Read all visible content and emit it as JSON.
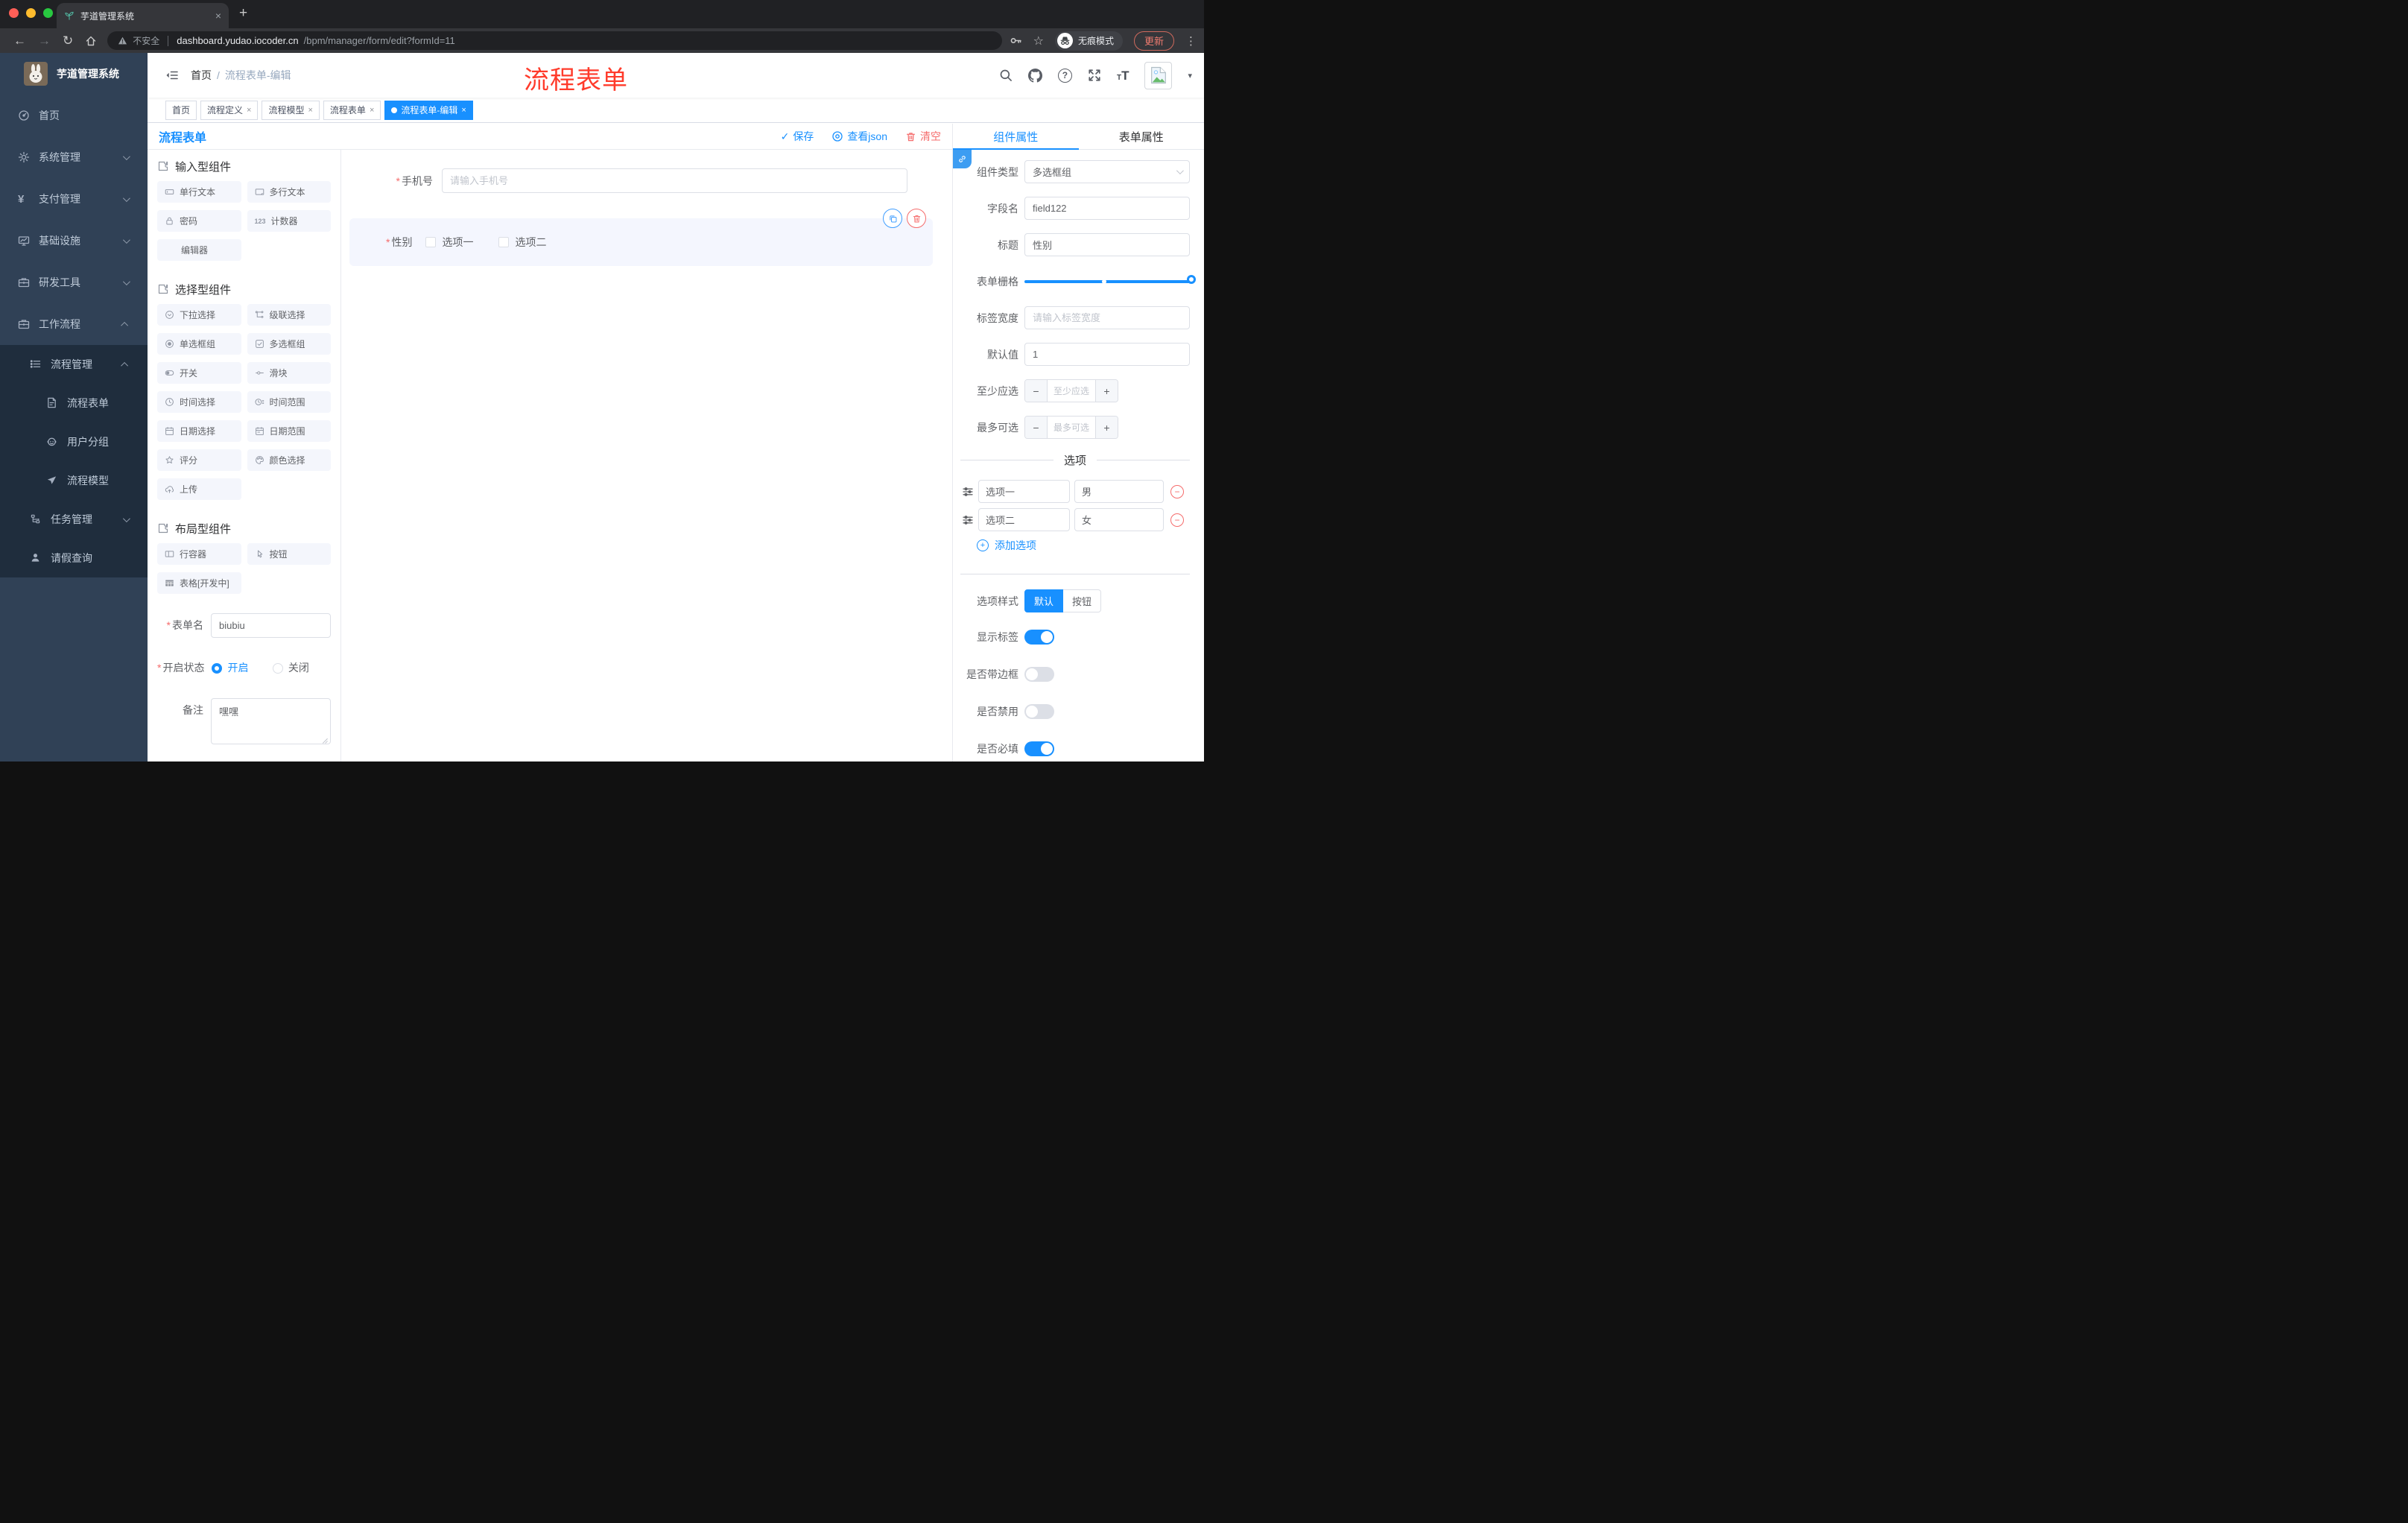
{
  "browser": {
    "tab_title": "芋道管理系统",
    "security_label": "不安全",
    "url_host": "dashboard.yudao.iocoder.cn",
    "url_path": "/bpm/manager/form/edit?formId=11",
    "incognito_label": "无痕模式",
    "update_label": "更新"
  },
  "icons": {
    "close": "×",
    "plus": "+",
    "back": "←",
    "forward": "→",
    "reload": "↻",
    "overflow": "⋮",
    "star": "☆",
    "help": "?",
    "check": "✓",
    "minus": "−",
    "caret_down": "▾",
    "slash": "/",
    "asterisk": "*",
    "counter": "123",
    "letter_t": "T"
  },
  "sidebar": {
    "app_title": "芋道管理系统",
    "items": [
      {
        "label": "首页"
      },
      {
        "label": "系统管理"
      },
      {
        "label": "支付管理"
      },
      {
        "label": "基础设施"
      },
      {
        "label": "研发工具"
      },
      {
        "label": "工作流程"
      }
    ],
    "sub_items": [
      {
        "label": "流程管理"
      },
      {
        "label": "流程表单"
      },
      {
        "label": "用户分组"
      },
      {
        "label": "流程模型"
      },
      {
        "label": "任务管理"
      },
      {
        "label": "请假查询"
      }
    ]
  },
  "header": {
    "breadcrumb_home": "首页",
    "breadcrumb_current": "流程表单-编辑",
    "annotation": "流程表单"
  },
  "tags": [
    {
      "label": "首页"
    },
    {
      "label": "流程定义"
    },
    {
      "label": "流程模型"
    },
    {
      "label": "流程表单"
    },
    {
      "label": "流程表单-编辑"
    }
  ],
  "designer": {
    "title": "流程表单",
    "save_label": "保存",
    "view_json_label": "查看json",
    "clear_label": "清空",
    "groups": [
      {
        "title": "输入型组件",
        "items": [
          "单行文本",
          "多行文本",
          "密码",
          "计数器",
          "编辑器"
        ]
      },
      {
        "title": "选择型组件",
        "items": [
          "下拉选择",
          "级联选择",
          "单选框组",
          "多选框组",
          "开关",
          "滑块",
          "时间选择",
          "时间范围",
          "日期选择",
          "日期范围",
          "评分",
          "颜色选择",
          "上传"
        ]
      },
      {
        "title": "布局型组件",
        "items": [
          "行容器",
          "按钮",
          "表格[开发中]"
        ]
      }
    ],
    "canvas": {
      "phone_label": "手机号",
      "phone_placeholder": "请输入手机号",
      "gender_label": "性别",
      "gender_options": [
        "选项一",
        "选项二"
      ]
    },
    "meta": {
      "form_name_label": "表单名",
      "form_name_value": "biubiu",
      "status_label": "开启状态",
      "status_on": "开启",
      "status_off": "关闭",
      "remark_label": "备注",
      "remark_value": "嘿嘿"
    }
  },
  "panel": {
    "tab_component": "组件属性",
    "tab_form": "表单属性",
    "type_label": "组件类型",
    "type_value": "多选框组",
    "field_label": "字段名",
    "field_value": "field122",
    "title_label": "标题",
    "title_value": "性别",
    "grid_label": "表单栅格",
    "label_width_label": "标签宽度",
    "label_width_placeholder": "请输入标签宽度",
    "default_label": "默认值",
    "default_value": "1",
    "min_label": "至少应选",
    "min_placeholder": "至少应选",
    "max_label": "最多可选",
    "max_placeholder": "最多可选",
    "options_divider": "选项",
    "options": [
      {
        "label": "选项一",
        "value": "男"
      },
      {
        "label": "选项二",
        "value": "女"
      }
    ],
    "add_option_label": "添加选项",
    "style_label": "选项样式",
    "style_default": "默认",
    "style_button": "按钮",
    "toggles": [
      {
        "label": "显示标签",
        "on": true
      },
      {
        "label": "是否带边框",
        "on": false
      },
      {
        "label": "是否禁用",
        "on": false
      },
      {
        "label": "是否必填",
        "on": true
      }
    ]
  },
  "colors": {
    "accent": "#1890ff",
    "danger": "#f56c6c",
    "annotation": "#ff3b2b",
    "sidebar_bg": "#304156",
    "sidebar_submenu_bg": "#1f2d3d"
  }
}
